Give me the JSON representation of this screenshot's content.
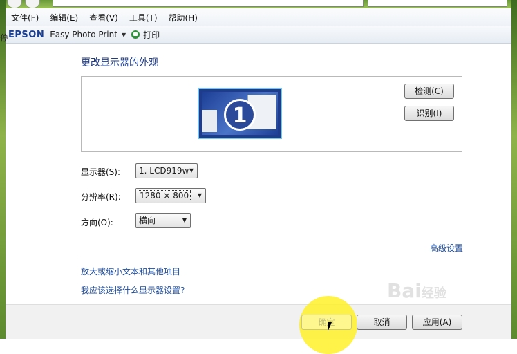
{
  "menubar": {
    "items": [
      "文件(F)",
      "编辑(E)",
      "查看(V)",
      "工具(T)",
      "帮助(H)"
    ]
  },
  "toolbar": {
    "brand": "EPSON",
    "app": "Easy Photo Print",
    "print_label": "打印",
    "side_glyph": "停"
  },
  "page": {
    "heading": "更改显示器的外观"
  },
  "monitor_panel": {
    "monitor_number": "1",
    "detect_button": "检测(C)",
    "identify_button": "识别(I)"
  },
  "settings": {
    "display_label": "显示器(S):",
    "display_value": "1. LCD919w",
    "resolution_label": "分辨率(R):",
    "resolution_value": "1280 × 800",
    "orientation_label": "方向(O):",
    "orientation_value": "横向"
  },
  "links": {
    "advanced": "高级设置",
    "text_size": "放大或缩小文本和其他项目",
    "which_settings": "我应该选择什么显示器设置?"
  },
  "footer": {
    "ok": "确定",
    "cancel": "取消",
    "apply": "应用(A)"
  },
  "watermark": {
    "text": "Bai",
    "suffix": "经验"
  }
}
